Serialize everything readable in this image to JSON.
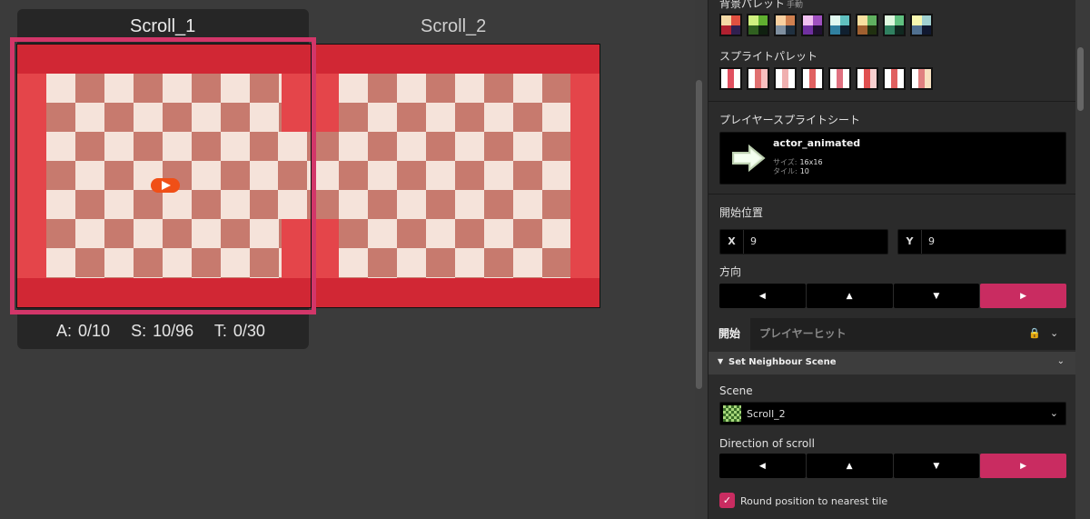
{
  "canvas": {
    "scene1": {
      "title": "Scroll_1",
      "stats": {
        "actors": "A: 0/10",
        "sprites": "S: 10/96",
        "triggers": "T: 0/30"
      }
    },
    "scene2": {
      "title": "Scroll_2"
    }
  },
  "panel": {
    "bg_palette_label": "背景パレット",
    "bg_palette_hint": "手動",
    "sprite_palette_label": "スプライトパレット",
    "player_sheet_label": "プレイヤースプライトシート",
    "sheet": {
      "name": "actor_animated",
      "size_label": "サイズ:",
      "size_value": "16x16",
      "tile_label": "タイル:",
      "tile_value": "10"
    },
    "start_pos_label": "開始位置",
    "x_label": "X",
    "x_value": "9",
    "y_label": "Y",
    "y_value": "9",
    "direction_label": "方向",
    "directions": [
      "◀",
      "▲",
      "▼",
      "▶"
    ],
    "tabs": {
      "start": "開始",
      "player_hit": "プレイヤーヒット"
    },
    "event": {
      "title": "Set Neighbour Scene",
      "scene_label": "Scene",
      "scene_value": "Scroll_2",
      "scroll_dir_label": "Direction of scroll",
      "round_label": "Round position to nearest tile"
    }
  },
  "colors": {
    "accent": "#c92c61",
    "selection": "#d23669",
    "wall": "#d12734",
    "floor_light": "#f5e3da",
    "floor_dark": "#c77a6e"
  }
}
